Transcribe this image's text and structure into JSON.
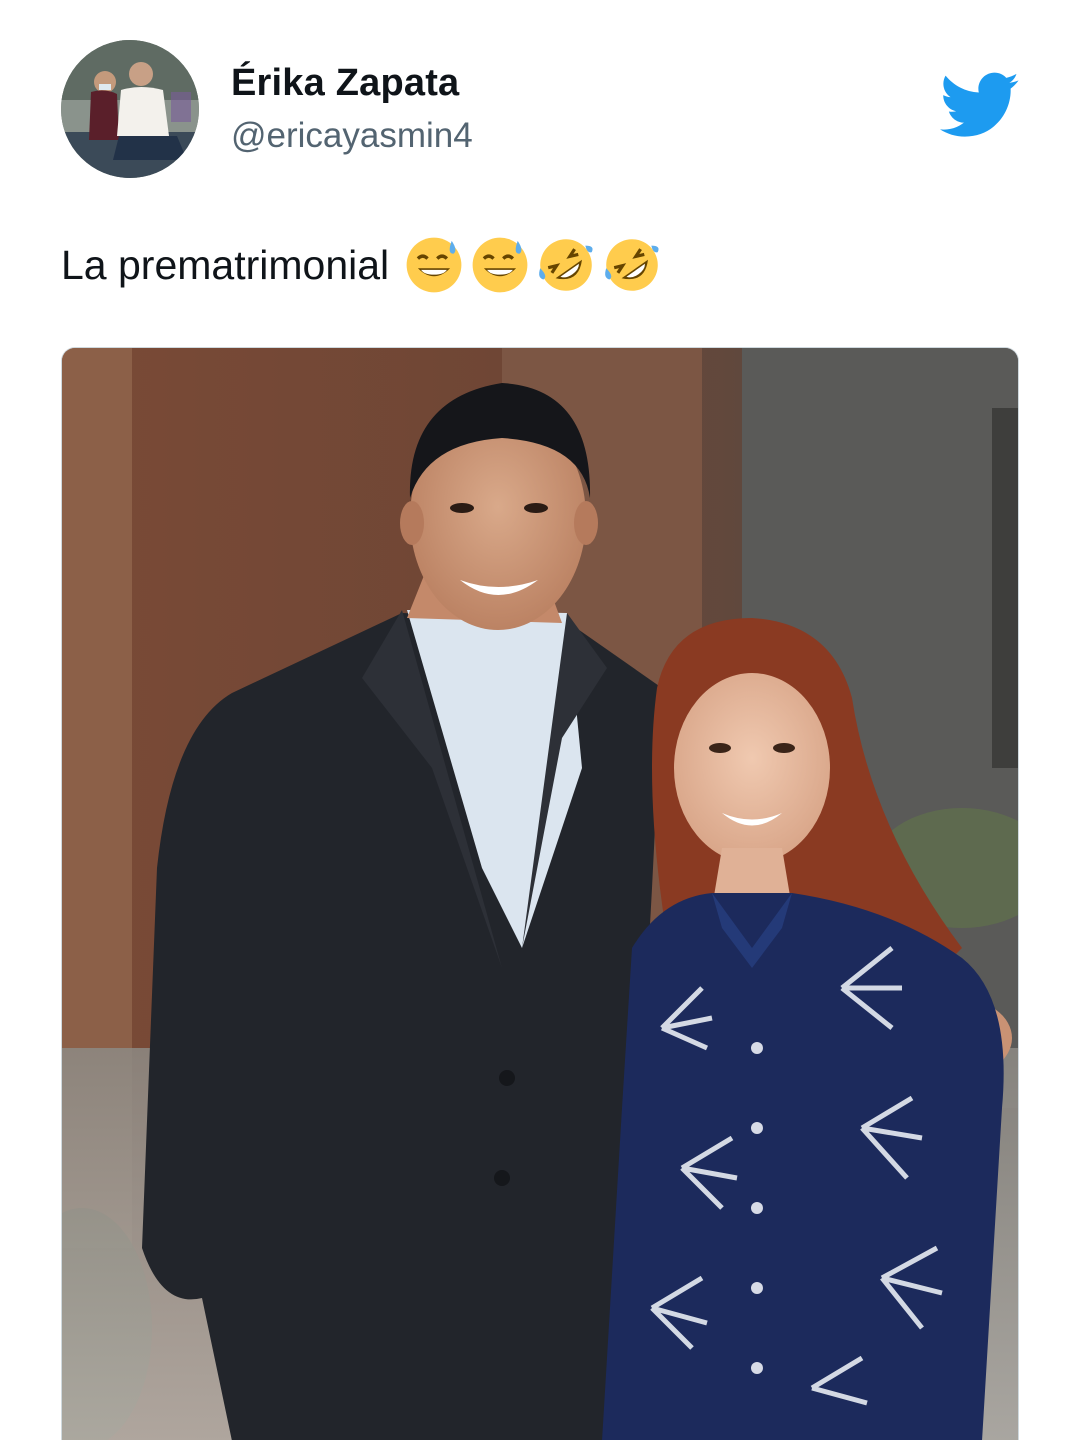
{
  "tweet": {
    "author": {
      "display_name": "Érika Zapata",
      "handle": "@ericayasmin4",
      "avatar_icon": "profile-photo"
    },
    "text": "La prematrimonial",
    "emojis": [
      "😅",
      "😅",
      "🤣",
      "🤣"
    ],
    "brand_icon": "twitter-bird-icon",
    "brand_color": "#1d9bf0",
    "media_icon": "photo-couple-portrait"
  }
}
